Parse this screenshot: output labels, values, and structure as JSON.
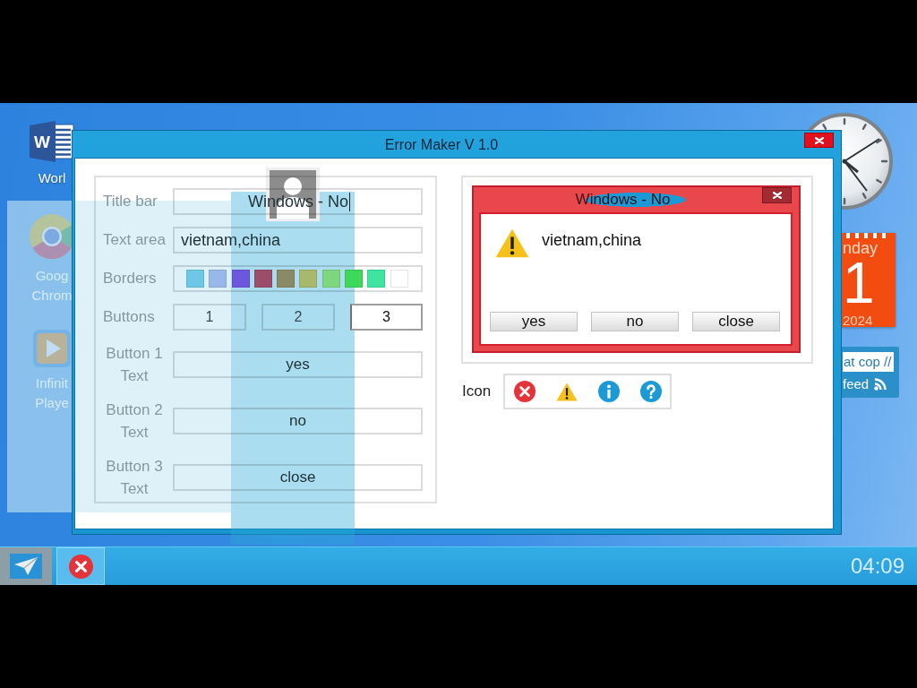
{
  "desktop": {
    "icons": [
      {
        "kind": "document",
        "badge": "W",
        "lines": [
          "Worl"
        ]
      },
      {
        "kind": "browser",
        "lines": [
          "Goog",
          "Chrom"
        ]
      },
      {
        "kind": "media",
        "lines": [
          "Infinit",
          "Playe"
        ]
      }
    ],
    "calendar": {
      "day": "nday",
      "date": "1",
      "year": "2024"
    },
    "feed": {
      "headline": "at cop //",
      "label": "feed"
    }
  },
  "window": {
    "title": "Error Maker V 1.0"
  },
  "form": {
    "rows": [
      {
        "kind": "title",
        "label": "Title bar",
        "value": "Windows - No",
        "focused": true
      },
      {
        "kind": "text",
        "label": "Text area",
        "value": "vietnam,china",
        "focused": false
      },
      {
        "kind": "swatches",
        "label": "Borders",
        "swatches": [
          {
            "color": "#6cc8e6"
          },
          {
            "color": "#98b8ec"
          },
          {
            "color": "#6c58dc"
          },
          {
            "color": "#9a4e6a"
          },
          {
            "color": "#8a8a66"
          },
          {
            "color": "#a8b86c"
          },
          {
            "color": "#7ed67e"
          },
          {
            "color": "#3ed85a"
          },
          {
            "color": "#40e4a0"
          },
          {
            "color": "#ffffff"
          }
        ]
      },
      {
        "kind": "count",
        "label": "Buttons",
        "options": [
          {
            "label": "1",
            "selected": false
          },
          {
            "label": "2",
            "selected": false
          },
          {
            "label": "3",
            "selected": true
          }
        ]
      },
      {
        "kind": "button_text",
        "label": "Button 1 Text",
        "value": "yes",
        "focused": false
      },
      {
        "kind": "button_text",
        "label": "Button 2 Text",
        "value": "no",
        "focused": false
      },
      {
        "kind": "button_text",
        "label": "Button 3 Text",
        "value": "close",
        "focused": false
      }
    ]
  },
  "preview": {
    "title": "Windows - No",
    "icon": {
      "kind": "warning"
    },
    "message": "vietnam,china",
    "buttons": [
      "yes",
      "no",
      "close"
    ]
  },
  "icon_picker": {
    "label": "Icon",
    "icons": [
      {
        "kind": "error"
      },
      {
        "kind": "warning"
      },
      {
        "kind": "info"
      },
      {
        "kind": "question"
      }
    ]
  },
  "taskbar": {
    "items": [
      {
        "kind": "plane",
        "selected": false
      },
      {
        "kind": "error",
        "selected": true
      }
    ],
    "clock": "04:09"
  }
}
